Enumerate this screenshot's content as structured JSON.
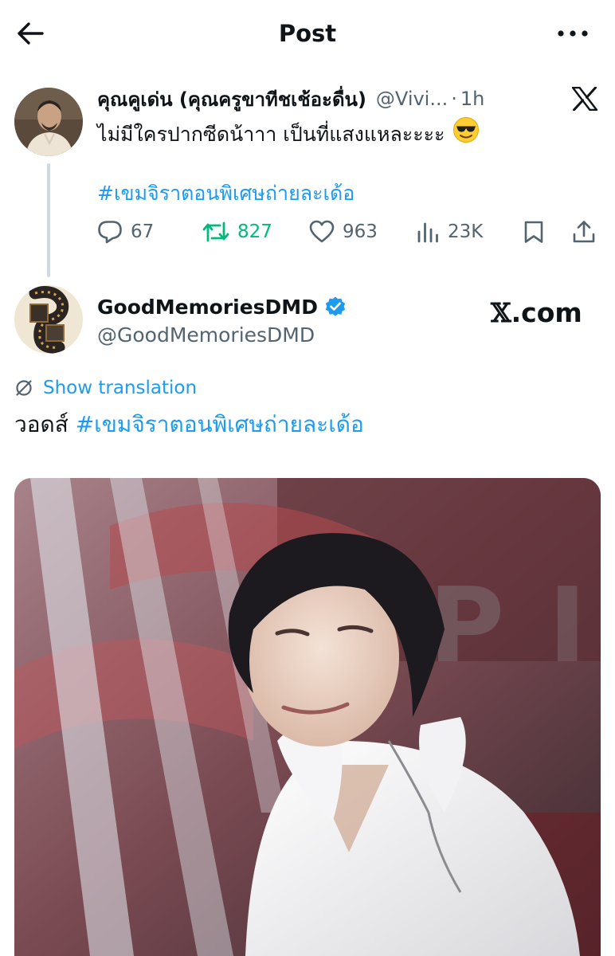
{
  "header": {
    "title": "Post",
    "back_icon": "arrow-left-icon",
    "more_icon": "more-horizontal-icon"
  },
  "parent_post": {
    "author_name": "คุณคูเด่น (คุณครูขาทีชเช้อะดื่น)",
    "handle": "@Vivi...",
    "separator": "·",
    "time": "1h",
    "text": "ไม่มีใครปากซีดน้าาา เป็นที่แสงแหละะะะ",
    "emoji": "😎",
    "hashtag": "#เขมจิราตอนพิเศษถ่ายละเด้อ",
    "stats": {
      "replies": "67",
      "reposts": "827",
      "likes": "963",
      "views": "23K"
    },
    "colors": {
      "repost_active": "#00ba7c"
    }
  },
  "main_post": {
    "author_name": "GoodMemoriesDMD",
    "handle": "@GoodMemoriesDMD",
    "watermark_x": "𝕏",
    "watermark_rest": ".com",
    "translate_label": "Show translation",
    "text_prefix": "วอดส์ ",
    "text_hashtag": "#เขมจิราตอนพิเศษถ่ายละเด้อ",
    "media_alt": "photo of a person in a white shirt on stage"
  },
  "colors": {
    "link": "#1d9bf0",
    "secondary_text": "#536471",
    "verified": "#1d9bf0",
    "thread_line": "#cfd9de"
  }
}
